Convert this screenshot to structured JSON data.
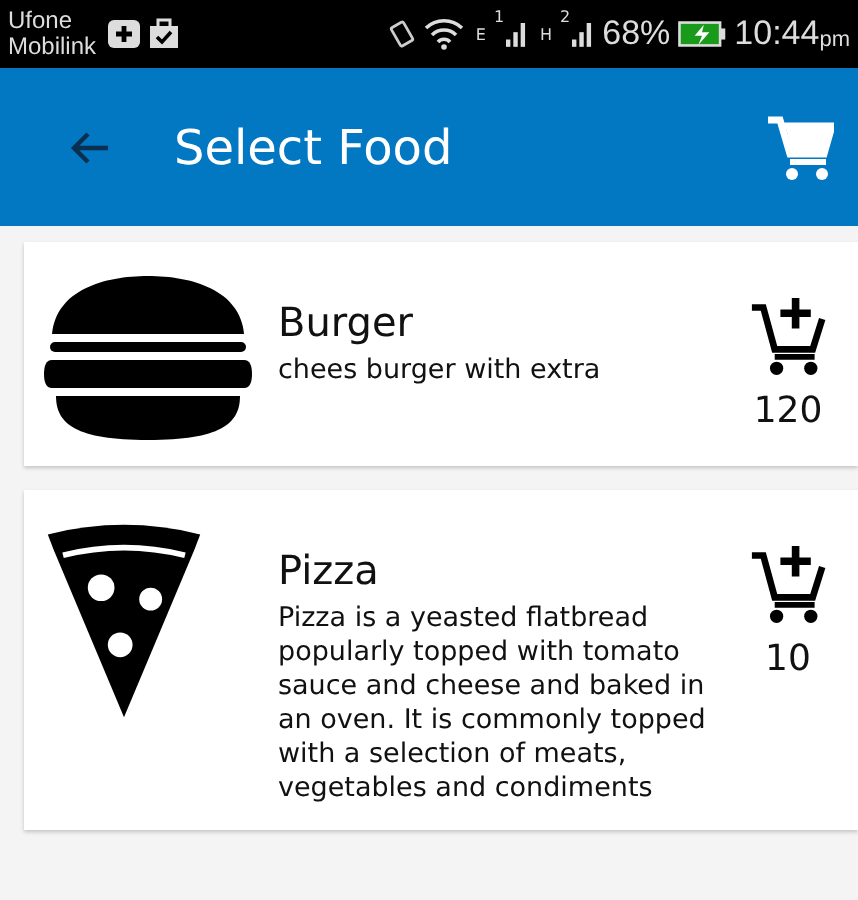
{
  "status_bar": {
    "carriers": [
      "Ufone",
      "Mobilink"
    ],
    "network_1": {
      "type": "E",
      "sim": "1"
    },
    "network_2": {
      "type": "H",
      "sim": "2"
    },
    "battery": "68%",
    "time": "10:44",
    "ampm": "pm"
  },
  "app_bar": {
    "title": "Select Food"
  },
  "foods": [
    {
      "kind": "burger",
      "name": "Burger",
      "description": "chees burger with extra",
      "price": "120"
    },
    {
      "kind": "pizza",
      "name": "Pizza",
      "description": "Pizza is a yeasted flatbread popularly topped with tomato sauce and cheese and baked in an oven. It is commonly topped with a selection of meats, vegetables and condiments",
      "price": "10"
    }
  ]
}
